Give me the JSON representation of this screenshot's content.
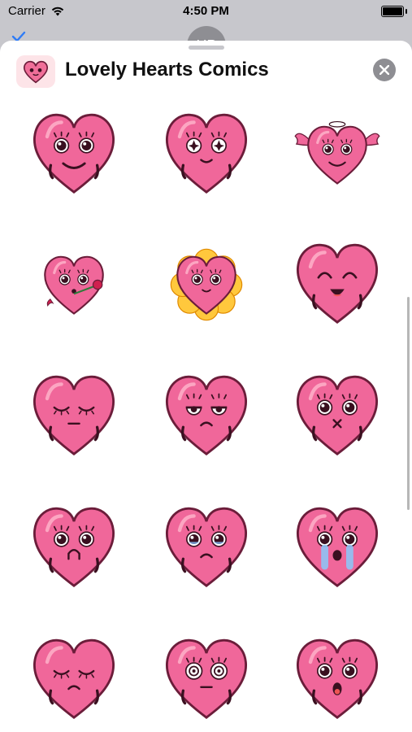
{
  "status": {
    "carrier": "Carrier",
    "time": "4:50 PM"
  },
  "behind": {
    "avatar_initials": "HP"
  },
  "header": {
    "title": "Lovely Hearts Comics"
  },
  "stickers": [
    {
      "name": "smile",
      "eyes": "big",
      "mouth": "smile",
      "hands": true
    },
    {
      "name": "starry-eyes",
      "eyes": "star",
      "mouth": "smile-small",
      "hands": true
    },
    {
      "name": "angel",
      "eyes": "big",
      "mouth": "smile",
      "extras": "angel"
    },
    {
      "name": "rose",
      "eyes": "big",
      "mouth": "o",
      "extras": "rose"
    },
    {
      "name": "flower",
      "eyes": "big",
      "mouth": "smile-small",
      "extras": "flower"
    },
    {
      "name": "giggle",
      "eyes": "happy",
      "mouth": "open",
      "hands": true
    },
    {
      "name": "sleepy",
      "eyes": "closed",
      "mouth": "flat",
      "hands": true
    },
    {
      "name": "annoyed",
      "eyes": "half",
      "mouth": "frown",
      "hands": true
    },
    {
      "name": "shushed",
      "eyes": "big",
      "mouth": "x",
      "hands": true
    },
    {
      "name": "worried",
      "eyes": "big",
      "mouth": "n",
      "hands": true
    },
    {
      "name": "teary",
      "eyes": "teary",
      "mouth": "frown",
      "hands": true
    },
    {
      "name": "crying",
      "eyes": "crying",
      "mouth": "open-sad",
      "hands": false
    },
    {
      "name": "sigh",
      "eyes": "closed-sad",
      "mouth": "frown",
      "hands": true
    },
    {
      "name": "dazed",
      "eyes": "dizzy",
      "mouth": "flat",
      "hands": true
    },
    {
      "name": "shocked",
      "eyes": "big",
      "mouth": "o-big",
      "hands": true
    }
  ]
}
